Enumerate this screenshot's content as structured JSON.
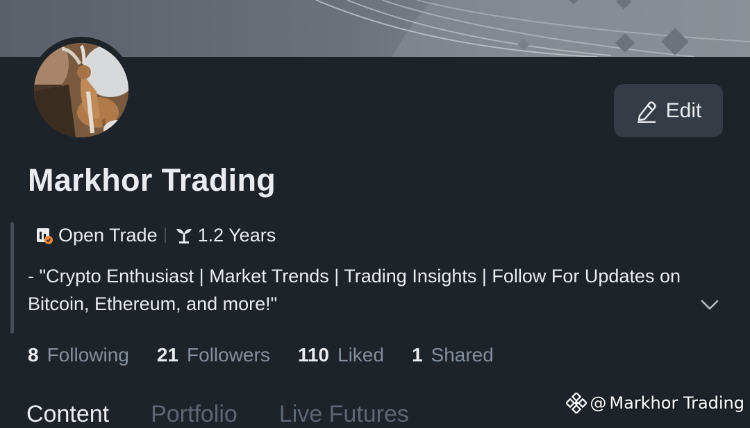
{
  "profile": {
    "name": "Markhor Trading",
    "edit_label": "Edit",
    "tags": [
      {
        "icon": "open-trade-icon",
        "label": "Open Trade"
      },
      {
        "icon": "sprout-icon",
        "label": "1.2 Years"
      }
    ],
    "bio": "- \"Crypto Enthusiast | Market Trends | Trading Insights | Follow For Updates on Bitcoin, Ethereum, and more!\""
  },
  "stats": [
    {
      "value": "8",
      "label": "Following"
    },
    {
      "value": "21",
      "label": "Followers"
    },
    {
      "value": "110",
      "label": "Liked"
    },
    {
      "value": "1",
      "label": "Shared"
    }
  ],
  "tabs": [
    {
      "label": "Content",
      "active": true
    },
    {
      "label": "Portfolio",
      "active": false
    },
    {
      "label": "Live Futures",
      "active": false
    }
  ],
  "watermark": {
    "at": "@",
    "name": "Markhor Trading"
  },
  "colors": {
    "background": "#1e2329",
    "text_primary": "#eaecef",
    "text_secondary": "#848e9c",
    "button_bg": "#363c45",
    "badge_orange": "#f0873a"
  }
}
